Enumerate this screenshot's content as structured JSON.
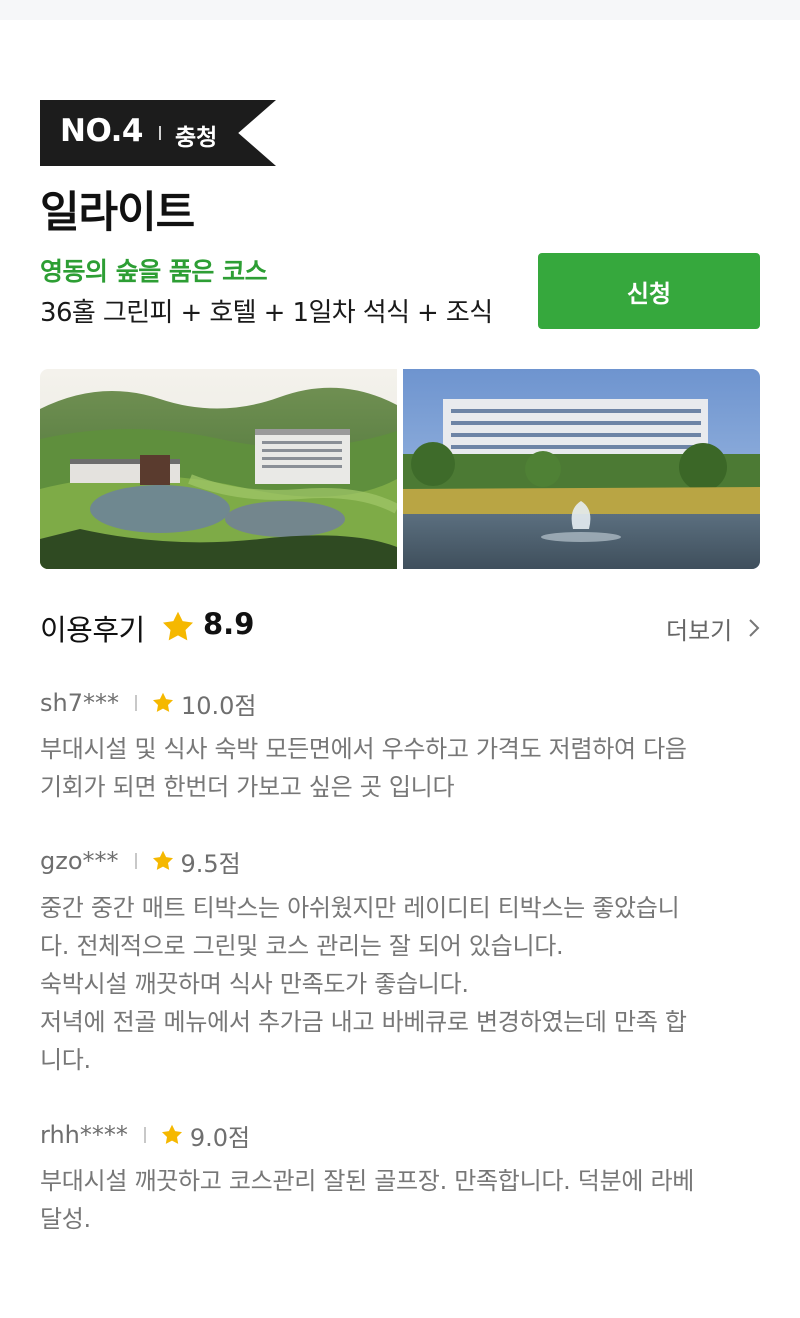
{
  "colors": {
    "accent_green": "#2d9e34",
    "button_green": "#36a83d",
    "banner_black": "#1c1c1c",
    "star_yellow": "#f5b800"
  },
  "rank": {
    "number": "NO.4",
    "region": "충청"
  },
  "course": {
    "name": "일라이트",
    "tagline": "영동의 숲을 품은 코스",
    "package": "36홀 그린피 + 호텔 + 1일차 석식 + 조식",
    "apply_label": "신청"
  },
  "photos": [
    {
      "icon": "golf-course-aerial-image"
    },
    {
      "icon": "hotel-with-fountain-image"
    }
  ],
  "reviews_header": {
    "title": "이용후기",
    "score": "8.9",
    "more_label": "더보기"
  },
  "reviews": [
    {
      "user": "sh7***",
      "rating": "10.0점",
      "lines": [
        "부대시설 및 식사 숙박 모든면에서 우수하고 가격도 저렴하여 다음",
        "기회가 되면 한번더 가보고 싶은 곳 입니다"
      ]
    },
    {
      "user": "gzo***",
      "rating": "9.5점",
      "lines": [
        "중간 중간 매트 티박스는 아쉬웠지만 레이디티 티박스는 좋았습니",
        "다. 전체적으로 그린및 코스 관리는 잘 되어 있습니다.",
        "숙박시설 깨끗하며 식사 만족도가 좋습니다.",
        "저녁에 전골 메뉴에서 추가금 내고 바베큐로 변경하였는데 만족 합",
        "니다."
      ]
    },
    {
      "user": "rhh****",
      "rating": "9.0점",
      "lines": [
        "부대시설 깨끗하고 코스관리 잘된 골프장. 만족합니다. 덕분에 라베",
        "달성."
      ]
    }
  ]
}
